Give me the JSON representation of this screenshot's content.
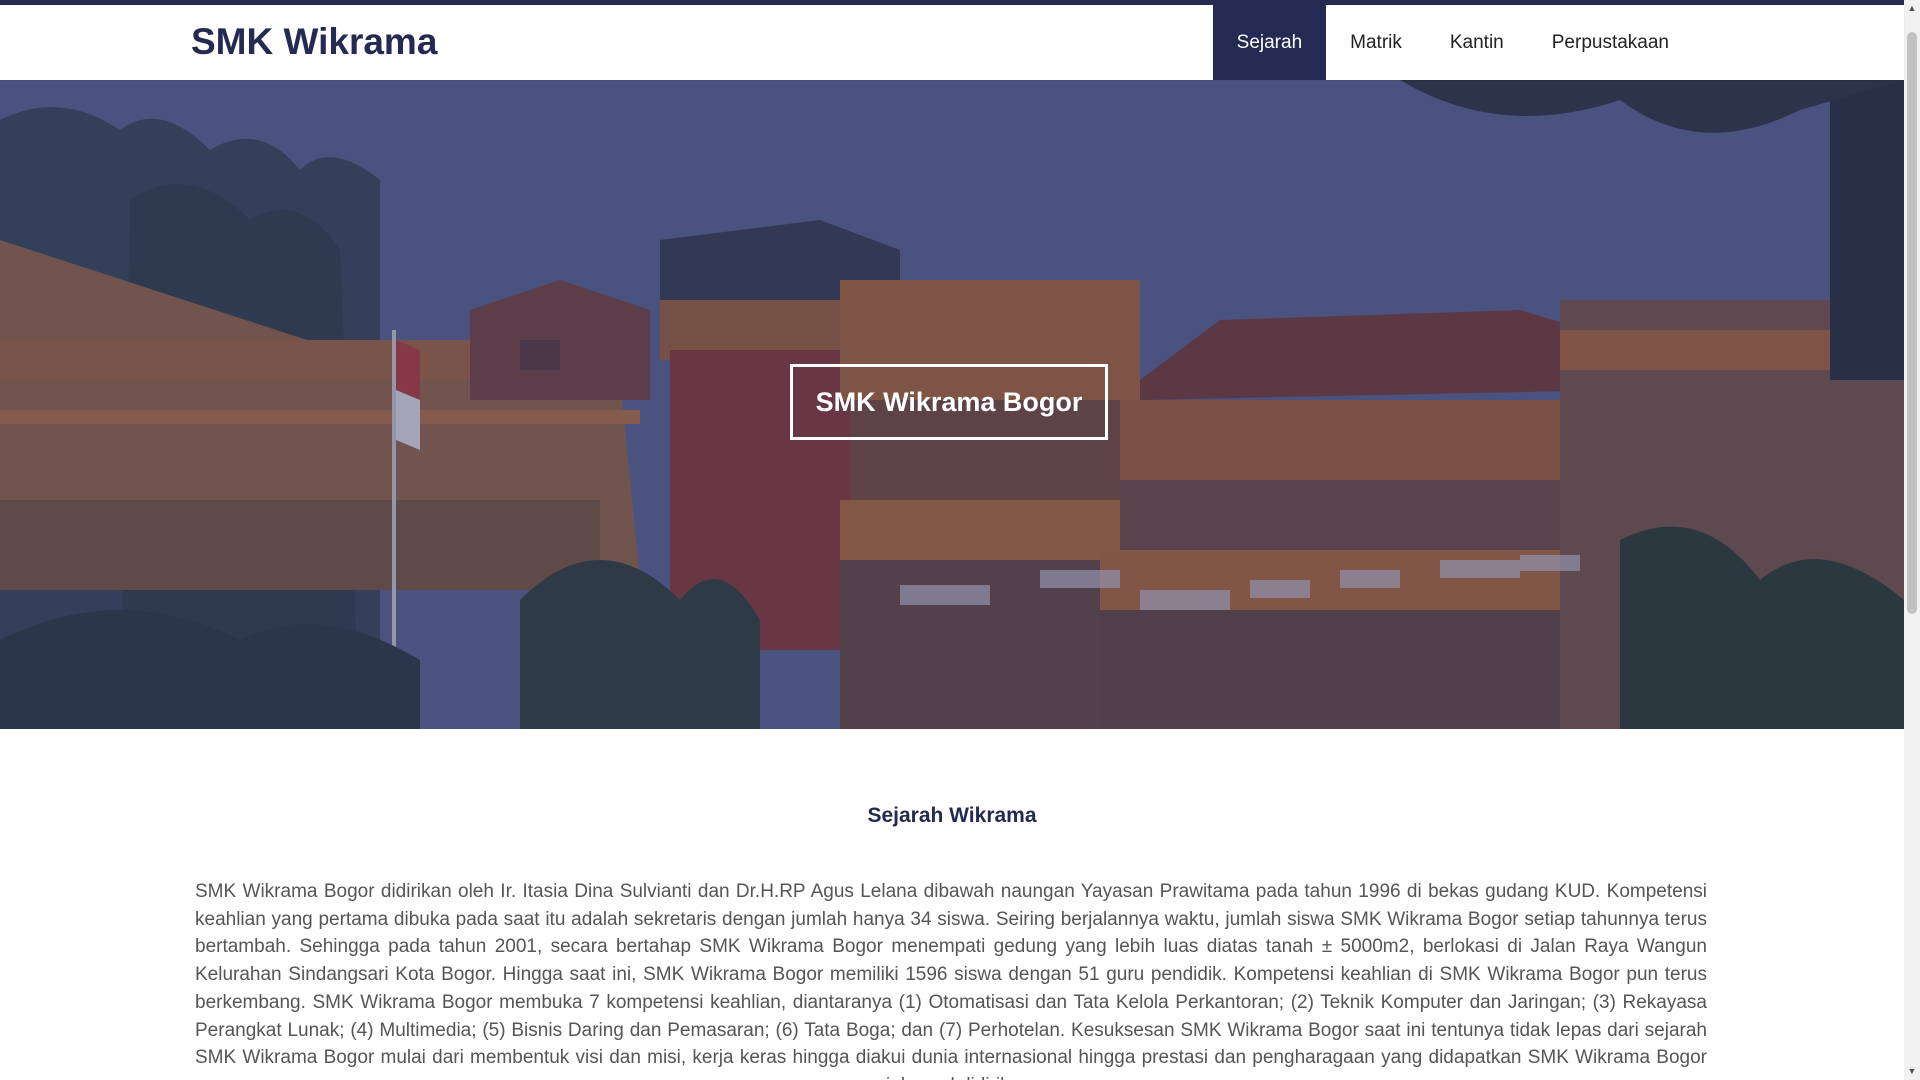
{
  "header": {
    "brand": "SMK Wikrama",
    "nav": [
      {
        "label": "Sejarah",
        "active": true
      },
      {
        "label": "Matrik",
        "active": false
      },
      {
        "label": "Kantin",
        "active": false
      },
      {
        "label": "Perpustakaan",
        "active": false
      }
    ]
  },
  "hero": {
    "title": "SMK Wikrama Bogor"
  },
  "section": {
    "title": "Sejarah Wikrama",
    "text": "SMK Wikrama Bogor didirikan oleh Ir. Itasia Dina Sulvianti dan Dr.H.RP Agus Lelana dibawah naungan Yayasan Prawitama pada tahun 1996 di bekas gudang KUD. Kompetensi keahlian yang pertama dibuka pada saat itu adalah sekretaris dengan jumlah hanya 34 siswa. Seiring berjalannya waktu, jumlah siswa SMK Wikrama Bogor setiap tahunnya terus bertambah. Sehingga pada tahun 2001, secara bertahap SMK Wikrama Bogor menempati gedung yang lebih luas diatas tanah ± 5000m2, berlokasi di Jalan Raya Wangun Kelurahan Sindangsari Kota Bogor. Hingga saat ini, SMK Wikrama Bogor memiliki 1596 siswa dengan 51 guru pendidik. Kompetensi keahlian di SMK Wikrama Bogor pun terus berkembang. SMK Wikrama Bogor membuka 7 kompetensi keahlian, diantaranya (1) Otomatisasi dan Tata Kelola Perkantoran; (2) Teknik Komputer dan Jaringan; (3) Rekayasa Perangkat Lunak; (4) Multimedia; (5) Bisnis Daring dan Pemasaran; (6) Tata Boga; dan (7) Perhotelan. Kesuksesan SMK Wikrama Bogor saat ini tentunya tidak lepas dari sejarah SMK Wikrama Bogor mulai dari membentuk visi dan misi, kerja keras hingga diakui dunia internasional hingga prestasi dan pengharagaan yang didapatkan SMK Wikrama Bogor sejak awal didirikan."
  },
  "colors": {
    "primary": "#242a52",
    "text": "#555555",
    "white": "#ffffff"
  }
}
